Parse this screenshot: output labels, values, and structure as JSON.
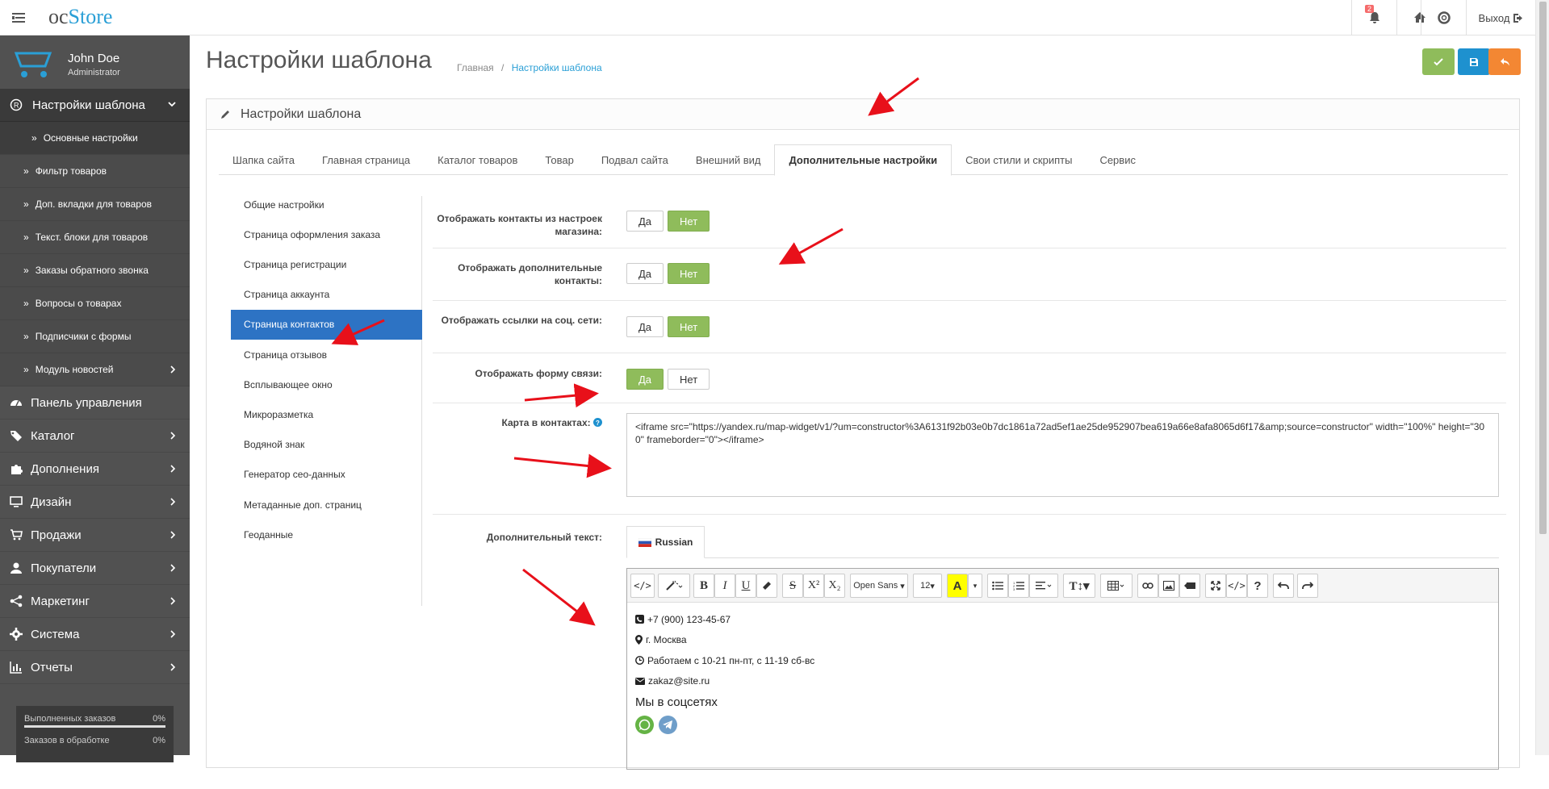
{
  "header": {
    "logo_oc": "oc",
    "logo_store": "Store",
    "notification_count": "2",
    "logout_label": "Выход"
  },
  "sidebar": {
    "user_name": "John Doe",
    "user_role": "Administrator",
    "group_label": "Настройки шаблона",
    "sub_items": [
      {
        "label": "Основные настройки",
        "active": true
      },
      {
        "label": "Фильтр товаров"
      },
      {
        "label": "Доп. вкладки для товаров"
      },
      {
        "label": "Текст. блоки для товаров"
      },
      {
        "label": "Заказы обратного звонка"
      },
      {
        "label": "Вопросы о товарах"
      },
      {
        "label": "Подписчики с формы"
      },
      {
        "label": "Модуль новостей"
      }
    ],
    "main_items": [
      {
        "label": "Панель управления",
        "icon": "dashboard-icon"
      },
      {
        "label": "Каталог",
        "icon": "tag-icon"
      },
      {
        "label": "Дополнения",
        "icon": "puzzle-icon"
      },
      {
        "label": "Дизайн",
        "icon": "monitor-icon"
      },
      {
        "label": "Продажи",
        "icon": "cart-icon"
      },
      {
        "label": "Покупатели",
        "icon": "user-icon"
      },
      {
        "label": "Маркетинг",
        "icon": "share-icon"
      },
      {
        "label": "Система",
        "icon": "gear-icon"
      },
      {
        "label": "Отчеты",
        "icon": "bar-chart-icon"
      }
    ],
    "stats": [
      {
        "label": "Выполненных заказов",
        "value": "0%"
      },
      {
        "label": "Заказов в обработке",
        "value": "0%"
      }
    ]
  },
  "page": {
    "title": "Настройки шаблона",
    "breadcrumb_home": "Главная",
    "breadcrumb_current": "Настройки шаблона",
    "panel_title": "Настройки шаблона"
  },
  "tabs": [
    "Шапка сайта",
    "Главная страница",
    "Каталог товаров",
    "Товар",
    "Подвал сайта",
    "Внешний вид",
    "Дополнительные настройки",
    "Свои стили и скрипты",
    "Сервис"
  ],
  "active_tab": "Дополнительные настройки",
  "vertical_nav": [
    "Общие настройки",
    "Страница оформления заказа",
    "Страница регистрации",
    "Страница аккаунта",
    "Страница контактов",
    "Страница отзывов",
    "Всплывающее окно",
    "Микроразметка",
    "Водяной знак",
    "Генератор сео-данных",
    "Метаданные доп. страниц",
    "Геоданные"
  ],
  "active_vertical": "Страница контактов",
  "form": {
    "yes": "Да",
    "no": "Нет",
    "rows": [
      {
        "label": "Отображать контакты из настроек магазина:",
        "value": "Нет"
      },
      {
        "label": "Отображать дополнительные контакты:",
        "value": "Нет"
      },
      {
        "label": "Отображать ссылки на соц. сети:",
        "value": "Нет"
      },
      {
        "label": "Отображать форму связи:",
        "value": "Да"
      }
    ],
    "map_label": "Карта в контактах:",
    "map_value": "<iframe src=\"https://yandex.ru/map-widget/v1/?um=constructor%3A6131f92b03e0b7dc1861a72ad5ef1ae25de952907bea619a66e8afa8065d6f17&amp;source=constructor\" width=\"100%\" height=\"300\" frameborder=\"0\"></iframe>",
    "extra_text_label": "Дополнительный текст:",
    "language_tab": "Russian"
  },
  "editor": {
    "font_name": "Open Sans",
    "font_size": "12",
    "content": {
      "phone": "+7 (900) 123-45-67",
      "city": "г. Москва",
      "hours": "Работаем с 10-21 пн-пт, с 11-19 сб-вс",
      "email": "zakaz@site.ru",
      "social_heading": "Мы в соцсетях"
    }
  },
  "colors": {
    "accent_blue": "#2d73c4",
    "toggle_green": "#8fbc5b",
    "save_green": "#8fbc5b",
    "btn_blue": "#1e91cf",
    "btn_orange": "#f38733",
    "sidebar_bg": "#515151",
    "arrow_red": "#e8101a"
  }
}
